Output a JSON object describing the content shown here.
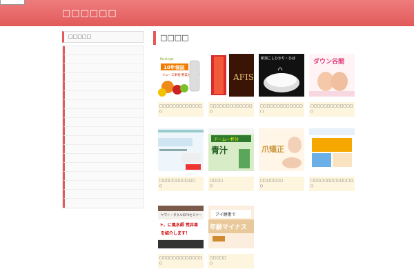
{
  "header": {
    "site_title": "□□□□□□"
  },
  "sidebar": {
    "heading": "□□□□□",
    "row_count": 18
  },
  "main": {
    "title": "□□□□"
  },
  "articles": [
    {
      "title": "□□□□□□□□□□□□□□□□□□□□□□□□□□□□",
      "date": "()"
    },
    {
      "title": "□□□□□□□□□□□□□",
      "date": "()"
    },
    {
      "title": "□□□□□□□□□□□□□□□□□□□□□□□□□□□□",
      "date": "( )"
    },
    {
      "title": "□□□□□□□□□□□□□□□□□□□",
      "date": "()"
    },
    {
      "title": "□□□□□□□□□□□",
      "date": "()"
    },
    {
      "title": "□□□□",
      "date": "()"
    },
    {
      "title": "□□□□□□□",
      "date": "()"
    },
    {
      "title": "□□□□□□□□□□□□□□□□□□□□V□□□□□□",
      "date": "()"
    },
    {
      "title": "□□□□□□□□□□□□□□□",
      "date": "()"
    },
    {
      "title": "□□□□□",
      "date": "()"
    }
  ],
  "thumb_texts": {
    "a1_banner": "10年保証",
    "a1_sub": "ジュース果物 野菜セット付",
    "a1_brand": "Kuvings",
    "a2_brand": "AFIS",
    "a3_head": "新潟こしひかり・ひば",
    "a4_text": "ダウン谷間",
    "a6_text": "青汁",
    "a6_band": "ドーム一杯分",
    "a7_text": "爪矯正",
    "a9_line1": "ヤマト・タクルのFXセミナー",
    "a9_line2": "ト、に風水師 荒井亜",
    "a9_line3": "を紹介します！",
    "a10_line1": "アイ酵素で",
    "a10_line2": "年齢マイナス"
  }
}
